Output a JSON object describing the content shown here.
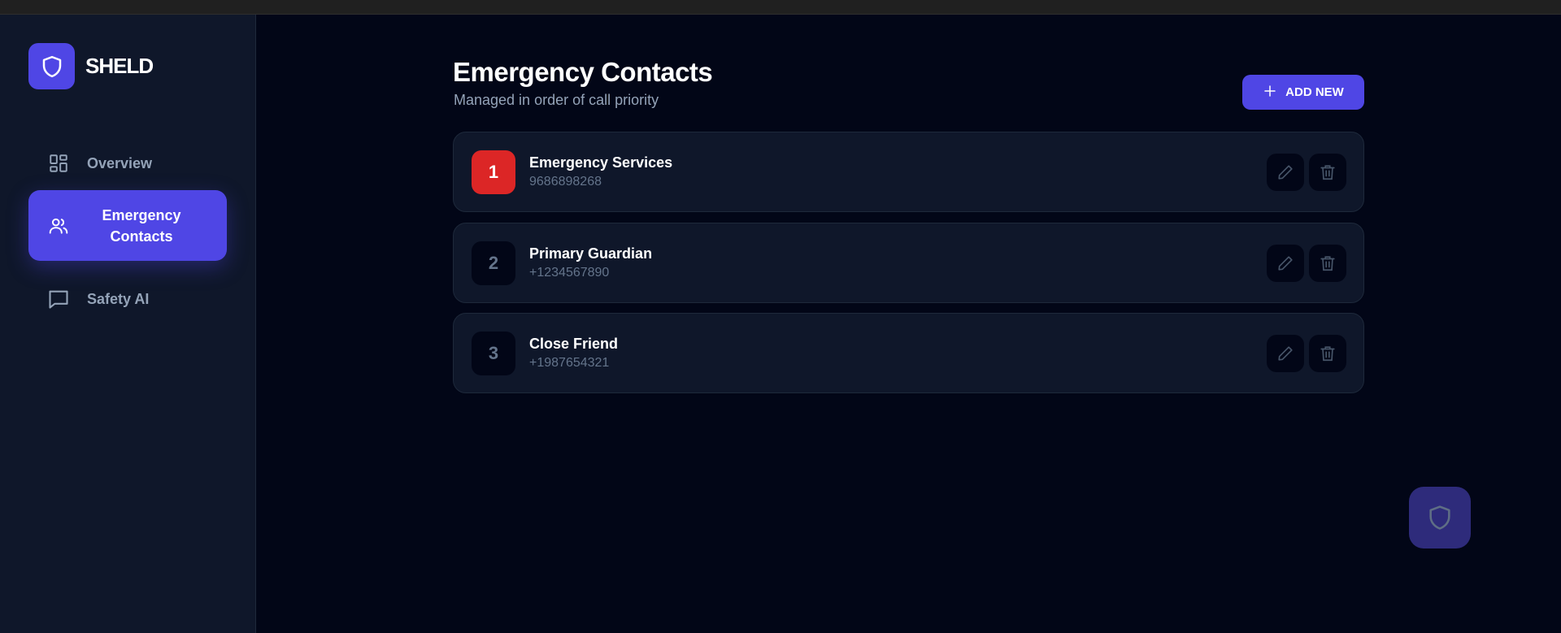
{
  "app": {
    "name": "SHELD"
  },
  "sidebar": {
    "items": [
      {
        "label": "Overview",
        "icon": "dashboard-icon",
        "active": false
      },
      {
        "label": "Emergency Contacts",
        "icon": "users-icon",
        "active": true
      },
      {
        "label": "Safety AI",
        "icon": "chat-icon",
        "active": false
      }
    ]
  },
  "main": {
    "title": "Emergency Contacts",
    "subtitle": "Managed in order of call priority",
    "add_button": {
      "label": "ADD NEW",
      "icon": "plus-icon"
    },
    "contacts": [
      {
        "rank": "1",
        "name": "Emergency Services",
        "phone": "9686898268"
      },
      {
        "rank": "2",
        "name": "Primary Guardian",
        "phone": "+1234567890"
      },
      {
        "rank": "3",
        "name": "Close Friend",
        "phone": "+1987654321"
      }
    ]
  },
  "colors": {
    "accent": "#4f46e5",
    "danger": "#dc2626",
    "background": "#020617",
    "surface": "#0f172a"
  }
}
